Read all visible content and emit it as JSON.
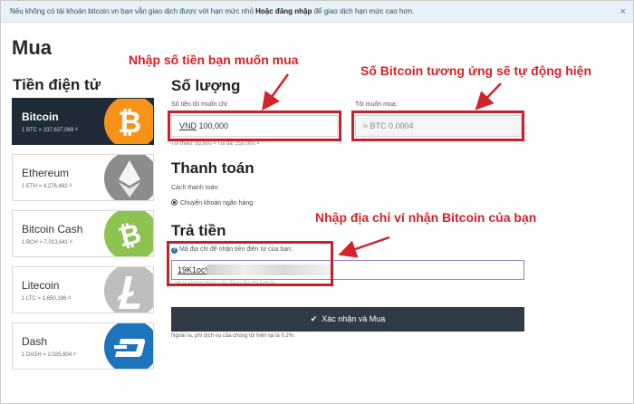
{
  "notice": {
    "text": "Nếu không có tài khoản bitcoin.vn bạn vẫn giao dịch được với hạn mức nhỏ ",
    "link": "Hoặc đăng nhập",
    "tail": " để giao dịch hạn mức cao hơn.",
    "close": "×"
  },
  "page_title": "Mua",
  "crypto": {
    "title": "Tiền điện tử",
    "coins": [
      {
        "name": "Bitcoin",
        "rate": "1 BTC = 237,637,069 ₫",
        "color": "#f7931a",
        "icon": "bitcoin-icon"
      },
      {
        "name": "Ethereum",
        "rate": "1 ETH = 4,276,462 ₫",
        "color": "#8c8c8c",
        "icon": "ethereum-icon"
      },
      {
        "name": "Bitcoin Cash",
        "rate": "1 BCH = 7,013,641 ₫",
        "color": "#8dc351",
        "icon": "bitcoin-cash-icon"
      },
      {
        "name": "Litecoin",
        "rate": "1 LTC = 1,650,186 ₫",
        "color": "#bebebe",
        "icon": "litecoin-icon"
      },
      {
        "name": "Dash",
        "rate": "1 DASH = 2,025,804 ₫",
        "color": "#1c75bc",
        "icon": "dash-icon"
      }
    ]
  },
  "quantity": {
    "title": "Số lượng",
    "vnd_label": "Số tiền tôi muốn chi:",
    "vnd_prefix": "VND",
    "vnd_value": "100,000",
    "btc_label": "Tôi muốn mua:",
    "btc_value": "≈ BTC 0.0004",
    "min_max": "Tối thiểu: 93,600 ₫   Tối đa: 250,000 ₫"
  },
  "payment": {
    "title": "Thanh toán",
    "method_label": "Cách thanh toán:",
    "method_value": "Chuyển khoản ngân hàng"
  },
  "pay": {
    "title": "Trả tiền",
    "wallet_label": "Mã địa chỉ để nhận tiền điện tử của bạn:",
    "wallet_value": "19K1oc\\",
    "wallet_hint": "Link ví không khớp cấp đăng địa chỉ hợp lệ",
    "submit": "Xác nhận và Mua",
    "footnote": "Ngoài ra, phí dịch vụ của chúng tôi hiện tại là 0.2%."
  },
  "annotations": {
    "enter_amount": "Nhập số tiền bạn muốn mua",
    "auto_bitcoin": "Số Bitcoin tương ứng sẽ tự động hiện",
    "enter_wallet": "Nhập địa chỉ ví nhận Bitcoin của bạn",
    "color": "#d2232a"
  }
}
